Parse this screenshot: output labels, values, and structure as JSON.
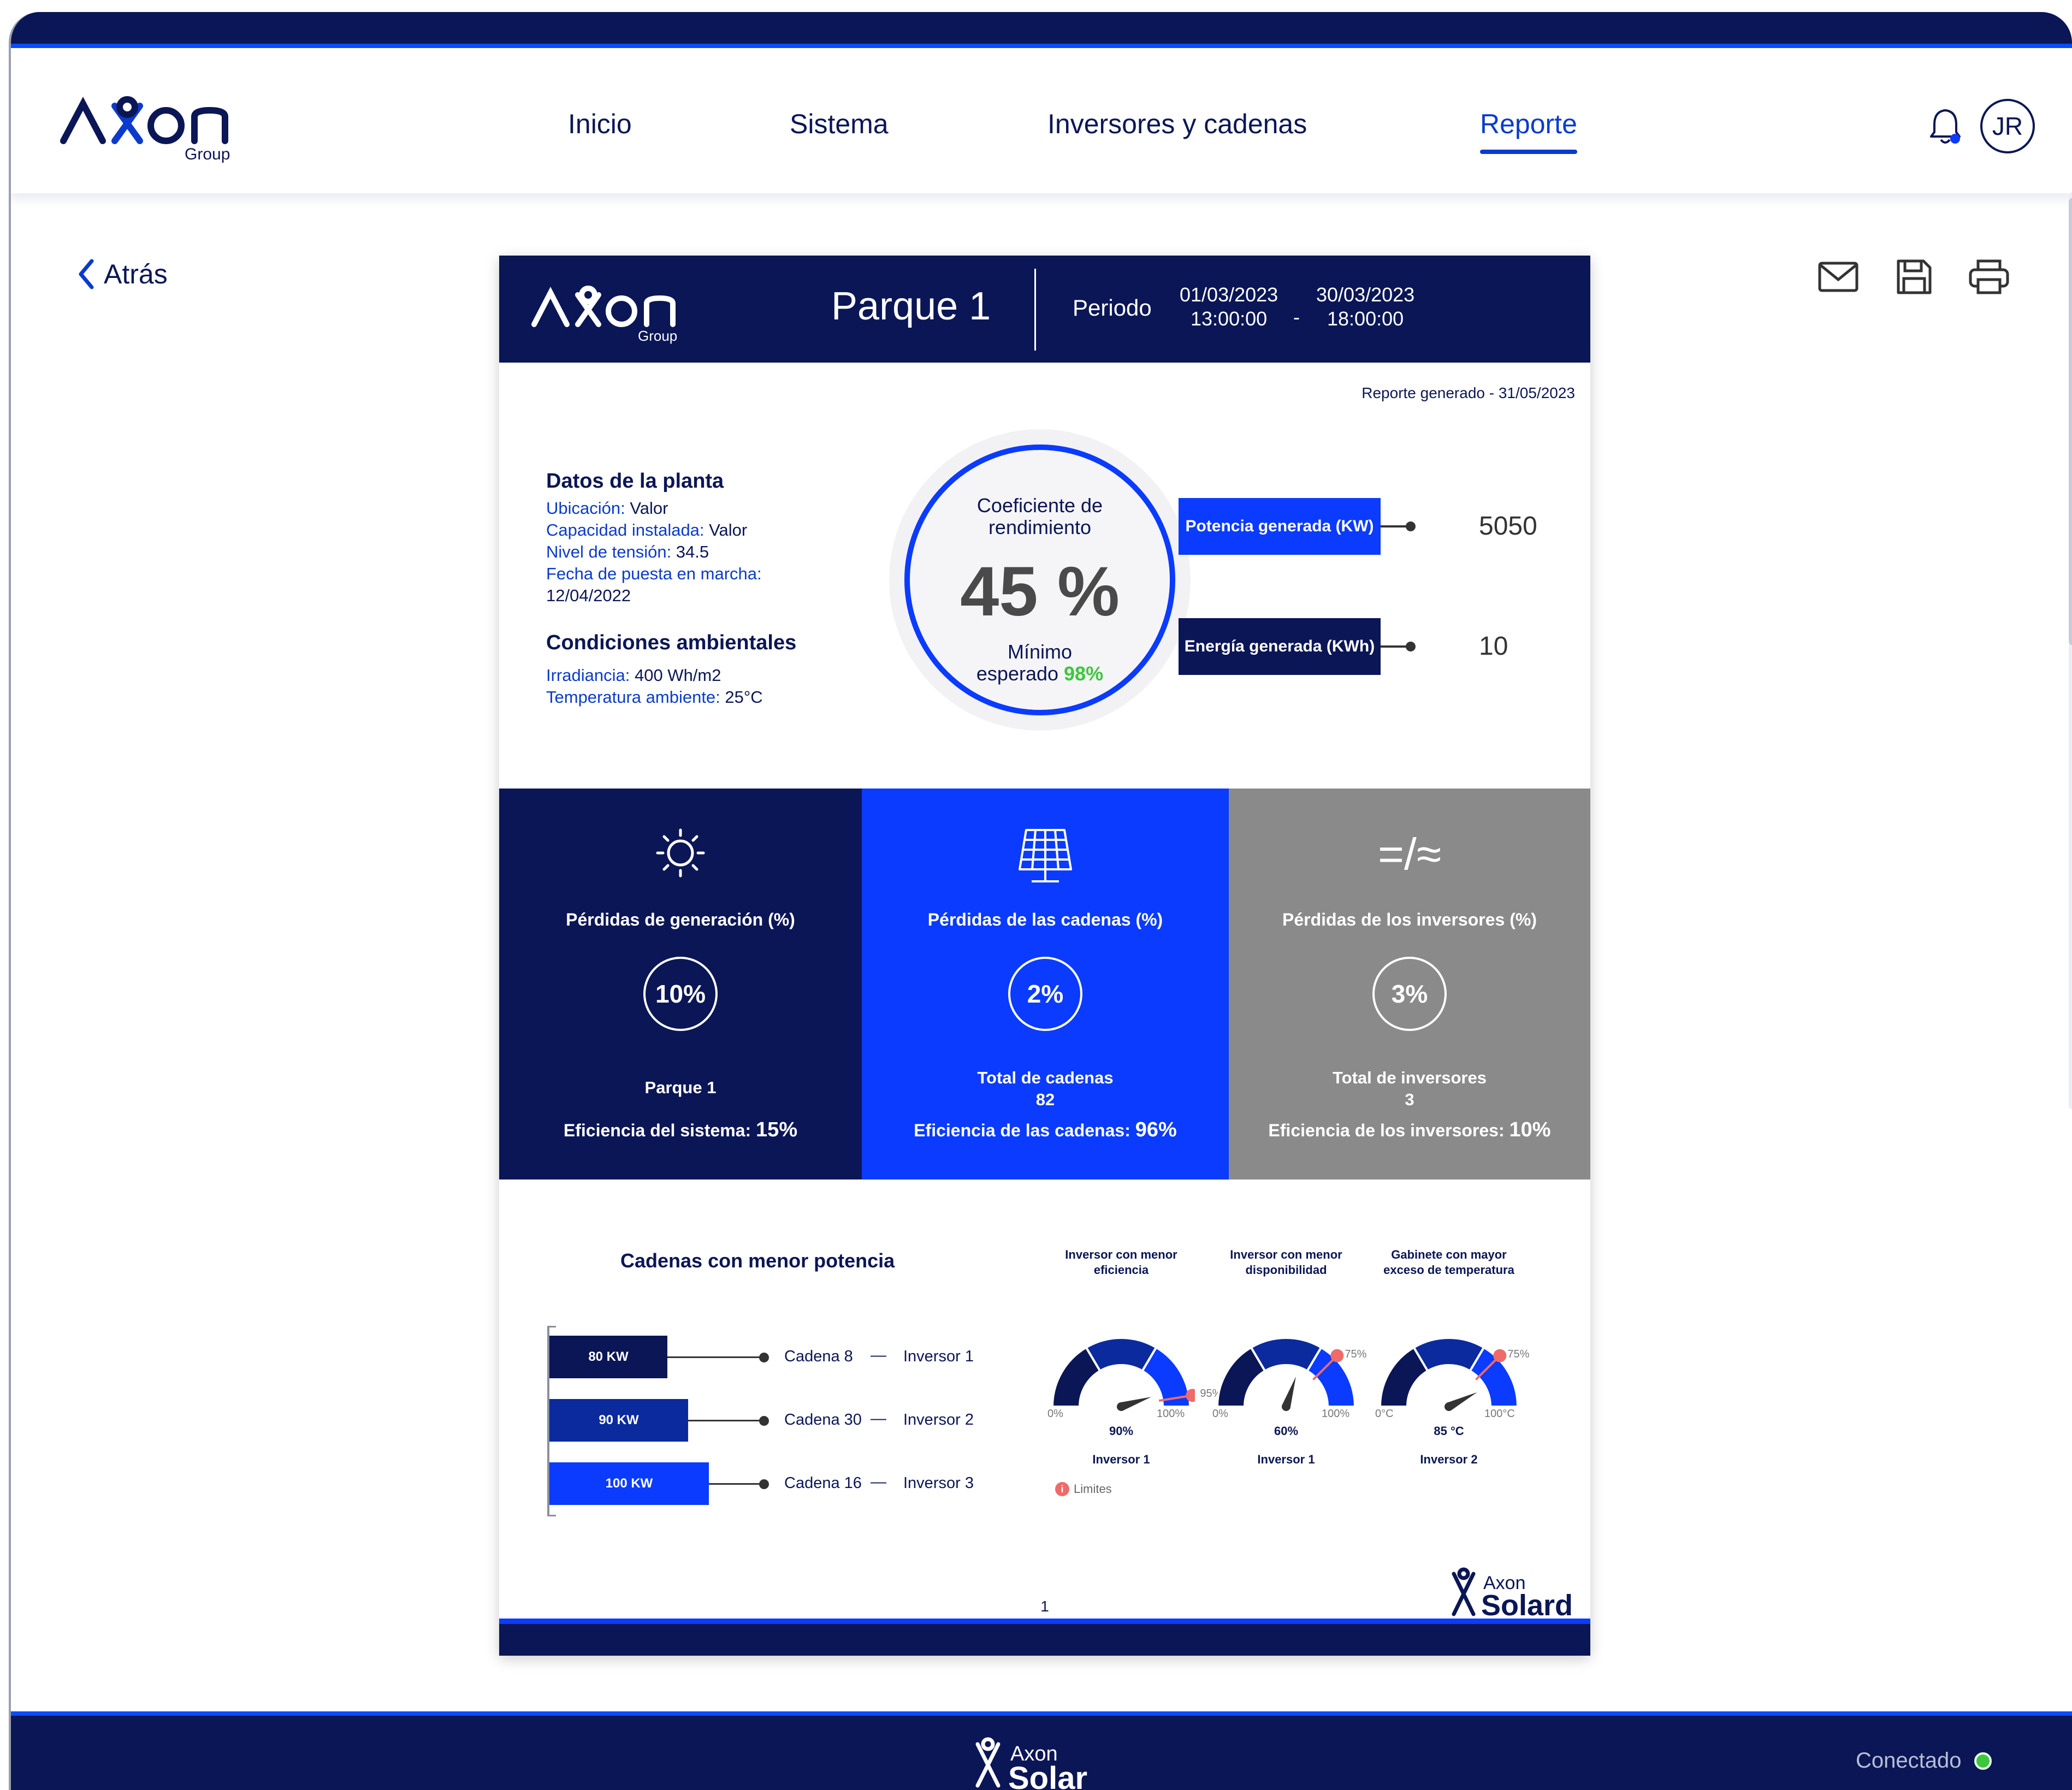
{
  "header": {
    "logo_word": "AXON",
    "logo_sub": "Group",
    "nav": [
      "Inicio",
      "Sistema",
      "Inversores y cadenas",
      "Reporte"
    ],
    "active_nav": "Reporte",
    "avatar_initials": "JR"
  },
  "back_label": "Atrás",
  "actions": {
    "email": "envelope-icon",
    "save": "floppy-disk-icon",
    "print": "printer-icon"
  },
  "report": {
    "logo_sub": "Group",
    "title": "Parque 1",
    "periodo_label": "Periodo",
    "start_date": "01/03/2023",
    "start_time": "13:00:00",
    "dash": "-",
    "end_date": "30/03/2023",
    "end_time": "18:00:00",
    "generated": "Reporte generado - 31/05/2023",
    "datos": {
      "title": "Datos de la planta",
      "ubicacion_label": "Ubicación:",
      "ubicacion_value": " Valor",
      "capacidad_label": "Capacidad instalada:",
      "capacidad_value": " Valor",
      "tension_label": "Nivel de tensión:",
      "tension_value": " 34.5",
      "fecha_label": "Fecha de puesta en marcha:",
      "fecha_value": "12/04/2022"
    },
    "condiciones": {
      "title": "Condiciones ambientales",
      "irradiancia_label": "Irradiancia:",
      "irradiancia_value": " 400 Wh/m2",
      "temperatura_label": "Temperatura ambiente:",
      "temperatura_value": " 25°C"
    },
    "coeficiente": {
      "title_line1": "Coeficiente de",
      "title_line2": "rendimiento",
      "value": "45 %",
      "min_line1": "Mínimo",
      "min_line2": "esperado ",
      "min_pct": "98%"
    },
    "potencia_label": "Potencia generada (KW)",
    "potencia_value": "5050",
    "energia_label": "Energía generada (KWh)",
    "energia_value": "10",
    "panels": [
      {
        "icon": "sun-icon",
        "title": "Pérdidas de generación (%)",
        "pct": "10%",
        "sub1": "Parque 1",
        "sub2": "",
        "eff_label": "Eficiencia del sistema: ",
        "eff_value": "15%"
      },
      {
        "icon": "solar-panel-icon",
        "title": "Pérdidas de las cadenas (%)",
        "pct": "2%",
        "sub1": "Total de cadenas",
        "sub2": "82",
        "eff_label": "Eficiencia de las cadenas: ",
        "eff_value": "96%"
      },
      {
        "icon": "dc-ac-icon",
        "icon_text": "=/≈",
        "title": "Pérdidas de los inversores (%)",
        "pct": "3%",
        "sub1": "Total de inversores",
        "sub2": "3",
        "eff_label": "Eficiencia de los inversores: ",
        "eff_value": "10%"
      }
    ],
    "cadenas": {
      "title": "Cadenas con menor potencia",
      "rows": [
        {
          "value": 80,
          "label": "80 KW",
          "cadena": "Cadena 8",
          "inversor": "Inversor 1",
          "color": "#0b1656"
        },
        {
          "value": 90,
          "label": "90 KW",
          "cadena": "Cadena 30",
          "inversor": "Inversor 2",
          "color": "#0a2a9e"
        },
        {
          "value": 100,
          "label": "100 KW",
          "cadena": "Cadena 16",
          "inversor": "Inversor 3",
          "color": "#0a3bff"
        }
      ],
      "dash": "—"
    },
    "gauges": [
      {
        "title": "Inversor con menor eficiencia",
        "value": 90,
        "value_label": "90%",
        "min_label": "0%",
        "max_label": "100%",
        "limit": 95,
        "limit_label": "95%",
        "name": "Inversor 1"
      },
      {
        "title": "Inversor con menor disponibilidad",
        "value": 60,
        "value_label": "60%",
        "min_label": "0%",
        "max_label": "100%",
        "limit": 75,
        "limit_label": "75%",
        "name": "Inversor 1"
      },
      {
        "title": "Gabinete con mayor exceso de temperatura",
        "value": 85,
        "value_label": "85 °C",
        "min_label": "0°C",
        "max_label": "100°C",
        "limit": 75,
        "limit_label": "75%",
        "name": "Inversor 2"
      }
    ],
    "limites_label": "Limites",
    "limites_icon": "i",
    "page_number": "1",
    "solard_top": "Axon",
    "solard_bottom": "Solard"
  },
  "footer": {
    "brand_top": "Axon",
    "brand_bottom": "Solar",
    "status": "Conectado"
  },
  "colors": {
    "navy": "#0b1656",
    "blue": "#0a3bff",
    "gray": "#8a8a8a",
    "ok": "#3ec63e",
    "alert": "#f06a6a"
  }
}
